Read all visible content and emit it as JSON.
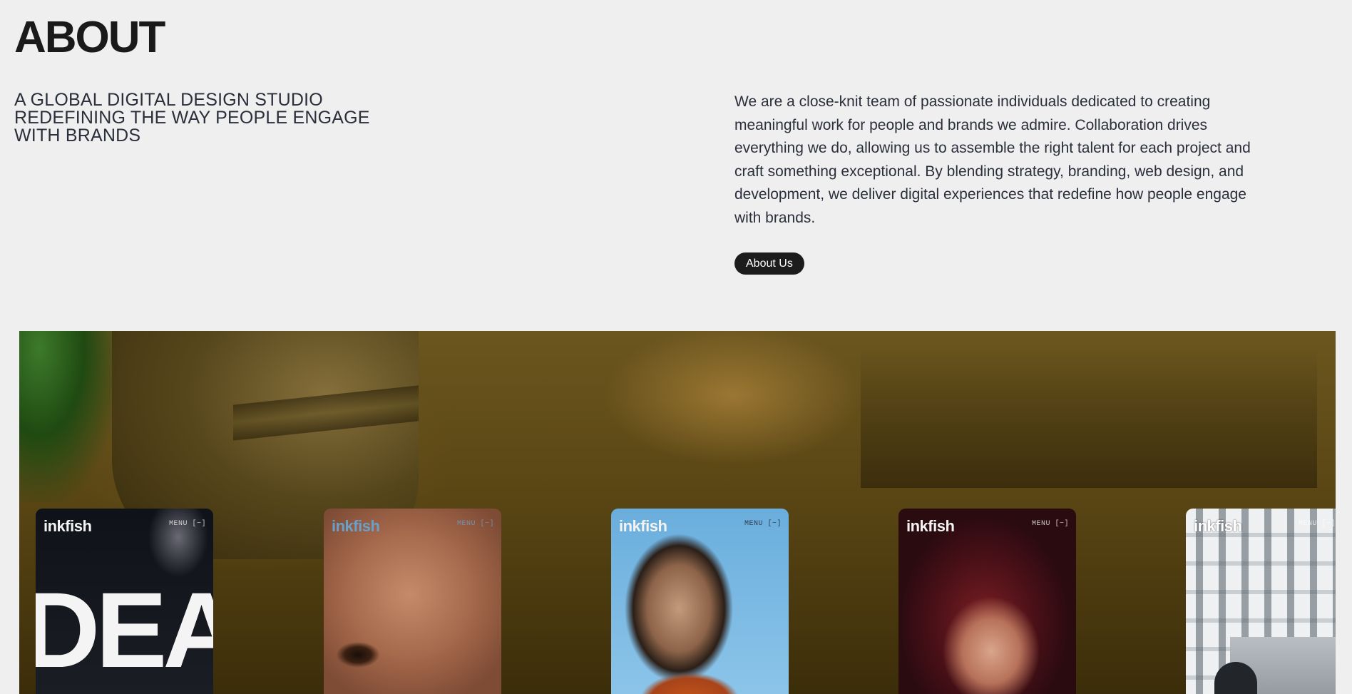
{
  "header": {
    "title": "ABOUT",
    "tagline": "A GLOBAL DIGITAL DESIGN STUDIO REDEFINING THE WAY PEOPLE ENGAGE WITH BRANDS"
  },
  "intro": {
    "text": "We are a close-knit team of passionate individuals dedicated to creating meaningful work for people and brands we admire. Collaboration drives everything we do, allowing us to assemble the right talent for each project and craft something exceptional. By blending strategy, branding, web design, and development, we deliver digital experiences that redefine how people engage with brands.",
    "button_label": "About Us"
  },
  "showcase": {
    "cards": [
      {
        "logo": "inkfish",
        "menu": "MENU [−]",
        "headline": "DEA"
      },
      {
        "logo": "inkfish",
        "menu": "MENU [−]"
      },
      {
        "logo": "inkfish",
        "menu": "MENU [−]"
      },
      {
        "logo": "inkfish",
        "menu": "MENU [−]"
      },
      {
        "logo": "inkfish",
        "menu": "MENU [−]"
      }
    ]
  },
  "colors": {
    "background": "#efefef",
    "text": "#2b2f3b",
    "button": "#1c1c1c"
  }
}
